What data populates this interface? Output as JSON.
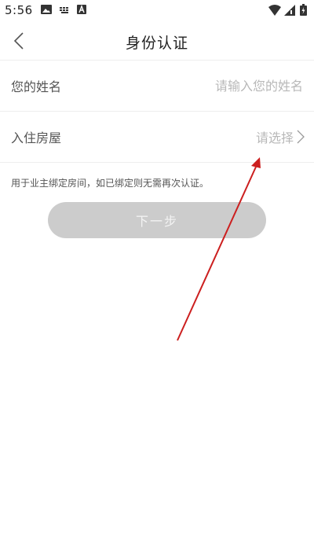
{
  "status_bar": {
    "time": "5:56",
    "icons": [
      "photo-icon",
      "keyboard-icon",
      "a-icon",
      "wifi-icon",
      "signal-icon",
      "battery-icon"
    ]
  },
  "header": {
    "back_icon": "chevron-left-icon",
    "title": "身份认证"
  },
  "form": {
    "name_row": {
      "label": "您的姓名",
      "placeholder": "请输入您的姓名",
      "value": ""
    },
    "house_row": {
      "label": "入住房屋",
      "placeholder": "请选择",
      "icon": "chevron-right-icon"
    }
  },
  "hint": "用于业主绑定房间，如已绑定则无需再次认证。",
  "next_button": {
    "label": "下一步",
    "state": "disabled"
  },
  "colors": {
    "annotation_arrow": "#cc1f1f",
    "button_disabled": "#cccccc",
    "divider": "#eeeeee",
    "placeholder": "#b8b8b8"
  }
}
